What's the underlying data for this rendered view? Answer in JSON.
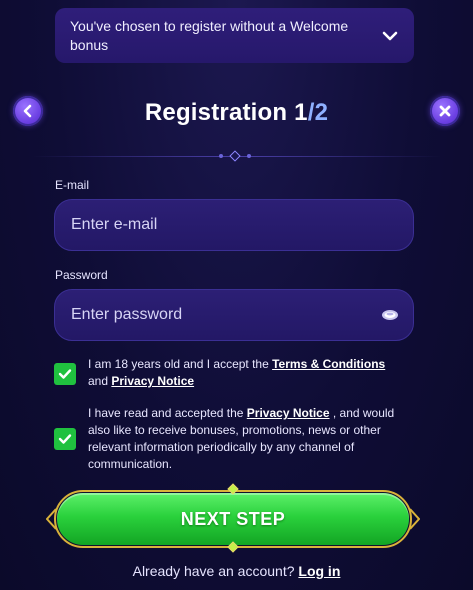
{
  "bonus": {
    "text": "You've chosen to register without a Welcome bonus"
  },
  "header": {
    "title": "Registration 1",
    "step_separator": "/",
    "step_total": "2"
  },
  "form": {
    "email_label": "E-mail",
    "email_placeholder": "Enter e-mail",
    "password_label": "Password",
    "password_placeholder": "Enter password"
  },
  "consents": {
    "age": {
      "prefix": "I am 18 years old and I accept the ",
      "terms_link": "Terms & Conditions",
      "middle": "and ",
      "privacy_link": "Privacy Notice"
    },
    "marketing": {
      "prefix": "I have read and accepted the ",
      "privacy_link": "Privacy Notice",
      "suffix": " , and would also like to receive bonuses, promotions, news or other relevant information periodically by any channel of communication."
    }
  },
  "actions": {
    "next_label": "NEXT STEP",
    "login_prompt": "Already have an account?",
    "login_link": "Log in"
  },
  "colors": {
    "background": "#0f0d36",
    "accent_purple": "#6b3fe2",
    "button_green": "#2ad13c",
    "frame_gold": "#d9b23a",
    "step_total": "#8fb0ff"
  },
  "icons": [
    "chevron-down-icon",
    "back-arrow-icon",
    "close-icon",
    "eye-icon",
    "checkmark-icon"
  ]
}
